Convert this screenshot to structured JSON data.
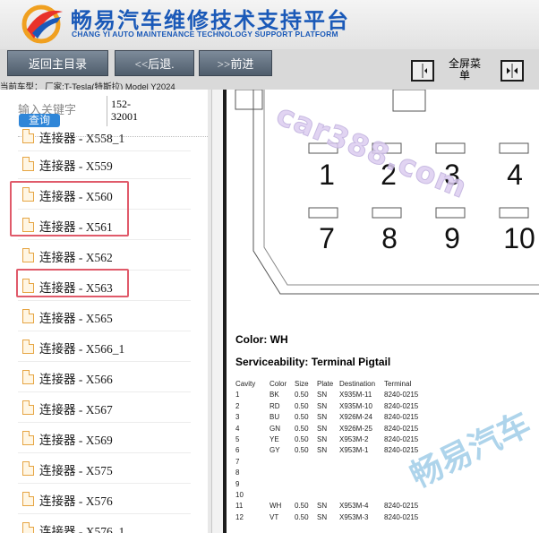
{
  "header": {
    "title_cn": "畅易汽车维修技术支持平台",
    "title_en": "CHANG YI AUTO MAINTENANCE TECHNOLOGY SUPPORT PLATFORM",
    "logo_icon": "cy-swoosh-logo-icon"
  },
  "toolbar": {
    "home_label": "返回主目录",
    "back_label": "<<后退.",
    "forward_label": ">>前进",
    "fullscreen_label": "全屏菜单",
    "collapse_icon": "panel-collapse-icon",
    "expand_icon": "panel-expand-icon"
  },
  "vehicle_info": "当前车型： 厂家:T-Tesla(特斯拉) Model Y2024",
  "search": {
    "placeholder": "输入关键字",
    "button_label": "查询",
    "code_value": "152-32001"
  },
  "tree": {
    "items": [
      {
        "label": "连接器 - X558_1"
      },
      {
        "label": "连接器 - X559"
      },
      {
        "label": "连接器 - X560"
      },
      {
        "label": "连接器 - X561"
      },
      {
        "label": "连接器 - X562"
      },
      {
        "label": "连接器 - X563"
      },
      {
        "label": "连接器 - X565"
      },
      {
        "label": "连接器 - X566_1"
      },
      {
        "label": "连接器 - X566"
      },
      {
        "label": "连接器 - X567"
      },
      {
        "label": "连接器 - X569"
      },
      {
        "label": "连接器 - X575"
      },
      {
        "label": "连接器 - X576"
      },
      {
        "label": "连接器 - X576_1"
      }
    ]
  },
  "diagram": {
    "pins_top": [
      "1",
      "2",
      "3",
      "4"
    ],
    "pins_bottom": [
      "7",
      "8",
      "9",
      "10"
    ]
  },
  "watermarks": {
    "site": "car388.com",
    "brand": "畅易汽车"
  },
  "content": {
    "color_heading": "Color: WH",
    "service_heading": "Serviceability: Terminal Pigtail",
    "table": {
      "headers": [
        "Cavity",
        "Color",
        "Size",
        "Plate",
        "Destination",
        "Terminal"
      ],
      "rows": [
        [
          "1",
          "BK",
          "0.50",
          "SN",
          "X935M-11",
          "8240-0215"
        ],
        [
          "2",
          "RD",
          "0.50",
          "SN",
          "X935M-10",
          "8240-0215"
        ],
        [
          "3",
          "BU",
          "0.50",
          "SN",
          "X926M-24",
          "8240-0215"
        ],
        [
          "4",
          "GN",
          "0.50",
          "SN",
          "X926M-25",
          "8240-0215"
        ],
        [
          "5",
          "YE",
          "0.50",
          "SN",
          "X953M-2",
          "8240-0215"
        ],
        [
          "6",
          "GY",
          "0.50",
          "SN",
          "X953M-1",
          "8240-0215"
        ],
        [
          "7",
          "",
          "",
          "",
          "",
          ""
        ],
        [
          "8",
          "",
          "",
          "",
          "",
          ""
        ],
        [
          "9",
          "",
          "",
          "",
          "",
          ""
        ],
        [
          "10",
          "",
          "",
          "",
          "",
          ""
        ],
        [
          "11",
          "WH",
          "0.50",
          "SN",
          "X953M-4",
          "8240-0215"
        ],
        [
          "12",
          "VT",
          "0.50",
          "SN",
          "X953M-3",
          "8240-0215"
        ]
      ]
    }
  },
  "colors": {
    "brand_blue": "#1a59b8",
    "button_gray": "#5f6d7c",
    "search_blue": "#2f86d8",
    "highlight_red": "#e05a6a",
    "file_icon_orange": "#e6a543"
  }
}
